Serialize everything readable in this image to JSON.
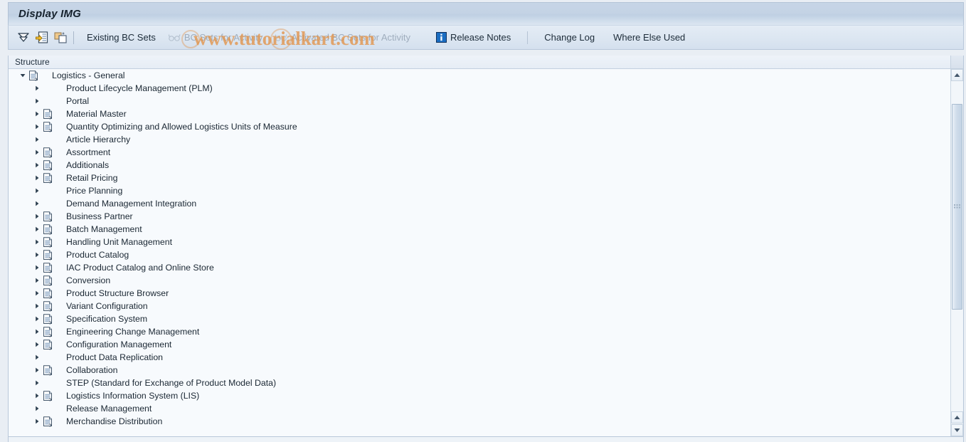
{
  "window": {
    "title": "Display IMG"
  },
  "toolbar": {
    "icons": [
      {
        "name": "expand-collapse-icon",
        "title": "Expand/Collapse"
      },
      {
        "name": "document-export-icon",
        "title": "Existing BC Sets"
      },
      {
        "name": "copy-objects-icon",
        "title": "Copy"
      }
    ],
    "buttons": [
      {
        "label": "Existing BC Sets",
        "name": "existing-bc-sets-button",
        "disabled": false,
        "icon": null
      },
      {
        "label": "BC Sets for Activity",
        "name": "bc-sets-for-activity-button",
        "disabled": true,
        "icon": "glasses-icon"
      },
      {
        "label": "Activated BC Sets for Activity",
        "name": "activated-bc-sets-for-activity-button",
        "disabled": true,
        "icon": "glasses-icon"
      },
      {
        "label": "Release Notes",
        "name": "release-notes-button",
        "disabled": false,
        "icon": "info-icon"
      },
      {
        "label": "Change Log",
        "name": "change-log-button",
        "disabled": false,
        "icon": null
      },
      {
        "label": "Where Else Used",
        "name": "where-else-used-button",
        "disabled": false,
        "icon": null
      }
    ]
  },
  "watermark": {
    "text": "www.tutorialkart.com",
    "color": "#e29248"
  },
  "structure": {
    "column_header": "Structure",
    "rows": [
      {
        "label": "Logistics - General",
        "level": 0,
        "arrow": "down",
        "has_doc_icon": true
      },
      {
        "label": "Product Lifecycle Management (PLM)",
        "level": 1,
        "arrow": "right",
        "has_doc_icon": false
      },
      {
        "label": "Portal",
        "level": 1,
        "arrow": "right",
        "has_doc_icon": false
      },
      {
        "label": "Material Master",
        "level": 1,
        "arrow": "right",
        "has_doc_icon": true
      },
      {
        "label": "Quantity Optimizing and Allowed Logistics Units of Measure",
        "level": 1,
        "arrow": "right",
        "has_doc_icon": true
      },
      {
        "label": "Article Hierarchy",
        "level": 1,
        "arrow": "right",
        "has_doc_icon": false
      },
      {
        "label": "Assortment",
        "level": 1,
        "arrow": "right",
        "has_doc_icon": true
      },
      {
        "label": "Additionals",
        "level": 1,
        "arrow": "right",
        "has_doc_icon": true
      },
      {
        "label": "Retail Pricing",
        "level": 1,
        "arrow": "right",
        "has_doc_icon": true
      },
      {
        "label": "Price Planning",
        "level": 1,
        "arrow": "right",
        "has_doc_icon": false
      },
      {
        "label": "Demand Management Integration",
        "level": 1,
        "arrow": "right",
        "has_doc_icon": false
      },
      {
        "label": "Business Partner",
        "level": 1,
        "arrow": "right",
        "has_doc_icon": true
      },
      {
        "label": "Batch Management",
        "level": 1,
        "arrow": "right",
        "has_doc_icon": true
      },
      {
        "label": "Handling Unit Management",
        "level": 1,
        "arrow": "right",
        "has_doc_icon": true
      },
      {
        "label": "Product Catalog",
        "level": 1,
        "arrow": "right",
        "has_doc_icon": true
      },
      {
        "label": "IAC Product Catalog and Online Store",
        "level": 1,
        "arrow": "right",
        "has_doc_icon": true
      },
      {
        "label": "Conversion",
        "level": 1,
        "arrow": "right",
        "has_doc_icon": true
      },
      {
        "label": "Product Structure Browser",
        "level": 1,
        "arrow": "right",
        "has_doc_icon": true
      },
      {
        "label": "Variant Configuration",
        "level": 1,
        "arrow": "right",
        "has_doc_icon": true
      },
      {
        "label": "Specification System",
        "level": 1,
        "arrow": "right",
        "has_doc_icon": true
      },
      {
        "label": "Engineering Change Management",
        "level": 1,
        "arrow": "right",
        "has_doc_icon": true
      },
      {
        "label": "Configuration Management",
        "level": 1,
        "arrow": "right",
        "has_doc_icon": true
      },
      {
        "label": "Product Data Replication",
        "level": 1,
        "arrow": "right",
        "has_doc_icon": false
      },
      {
        "label": "Collaboration",
        "level": 1,
        "arrow": "right",
        "has_doc_icon": true
      },
      {
        "label": "STEP (Standard for Exchange of Product Model Data)",
        "level": 1,
        "arrow": "right",
        "has_doc_icon": false
      },
      {
        "label": "Logistics Information System (LIS)",
        "level": 1,
        "arrow": "right",
        "has_doc_icon": true
      },
      {
        "label": "Release Management",
        "level": 1,
        "arrow": "right",
        "has_doc_icon": false
      },
      {
        "label": "Merchandise Distribution",
        "level": 1,
        "arrow": "right",
        "has_doc_icon": true
      }
    ]
  },
  "scrollbar": {
    "name": "vertical-scrollbar",
    "thumb_top_pct": 7,
    "thumb_height_pct": 65
  }
}
